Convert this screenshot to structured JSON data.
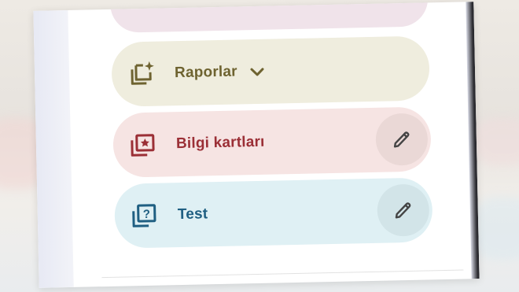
{
  "colors": {
    "raporlar_bg": "#efedde",
    "raporlar_fg": "#6e6330",
    "bilgi_bg": "#f6e4e3",
    "bilgi_fg": "#9b2f36",
    "test_bg": "#dff0f4",
    "test_fg": "#1f5f82"
  },
  "nav": {
    "items": [
      {
        "label": "Raporlar",
        "icon": "reports-sparkle-icon",
        "expandable": true
      },
      {
        "label": "Bilgi kartları",
        "icon": "flashcards-star-icon",
        "edit_icon": "pencil-icon"
      },
      {
        "label": "Test",
        "icon": "quiz-question-icon",
        "edit_icon": "pencil-icon"
      }
    ]
  }
}
